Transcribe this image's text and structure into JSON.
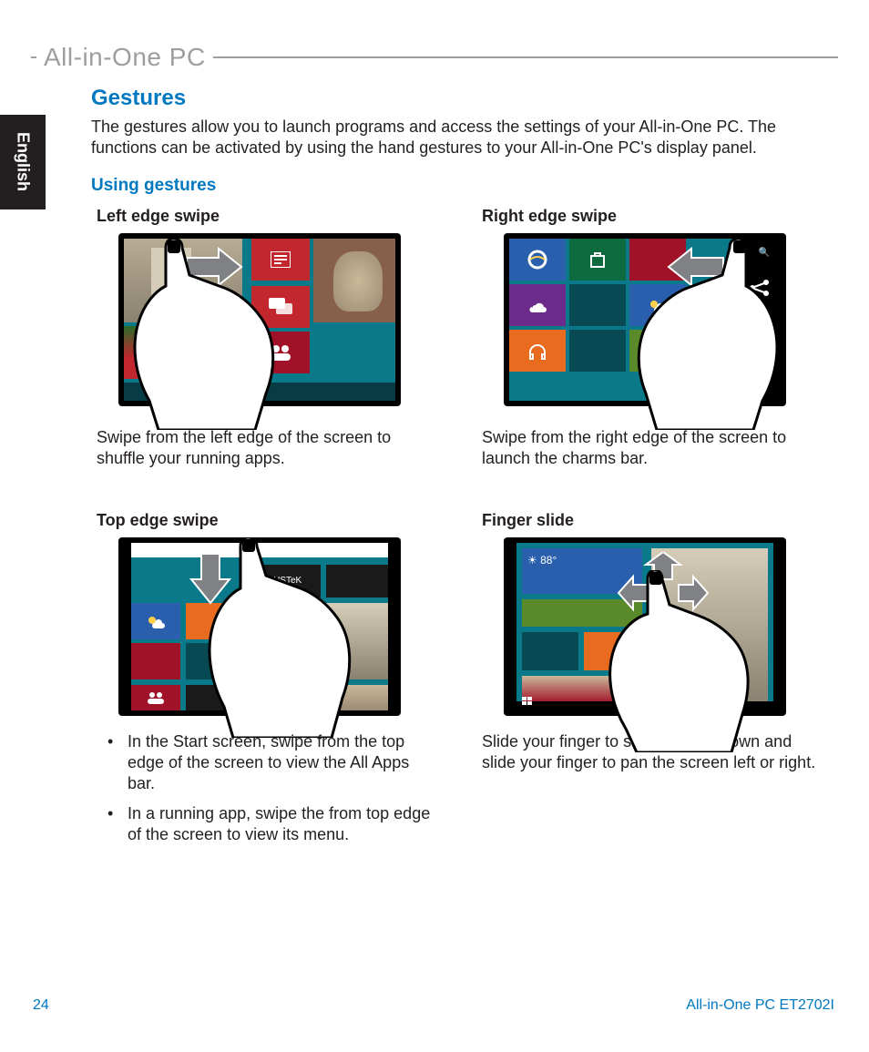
{
  "header": {
    "product_line": "All-in-One PC"
  },
  "language_tab": "English",
  "section_title": "Gestures",
  "intro_text": "The gestures allow you to launch programs and access the settings of your All-in-One PC. The functions can be activated by using the hand gestures to your All-in-One PC's display panel.",
  "subsection_title": "Using gestures",
  "gestures": [
    {
      "title": "Left edge swipe",
      "description": "Swipe from the left edge of the screen to shuffle your running apps."
    },
    {
      "title": "Right edge swipe",
      "description": "Swipe from the right edge of the screen to launch the charms bar."
    },
    {
      "title": "Top edge swipe",
      "bullets": [
        "In the Start screen, swipe from the top edge of the screen to view the All Apps bar.",
        "In a running app, swipe the from top edge of the screen to view its menu."
      ]
    },
    {
      "title": "Finger slide",
      "description": "Slide your finger to scroll up and down and slide your finger to pan the screen left or right."
    }
  ],
  "footer": {
    "page_number": "24",
    "model": "All-in-One PC ET2702I"
  },
  "colors": {
    "accent": "#0079c1",
    "header_gray": "#9c9e9f",
    "tile_red": "#c1272d",
    "tile_crimson": "#a01227",
    "tile_orange": "#e86b1f",
    "tile_teal": "#0a7a8a",
    "tile_green": "#5a8a2a",
    "tile_blue": "#2a5fad",
    "tile_dark": "#1a1a1a"
  }
}
